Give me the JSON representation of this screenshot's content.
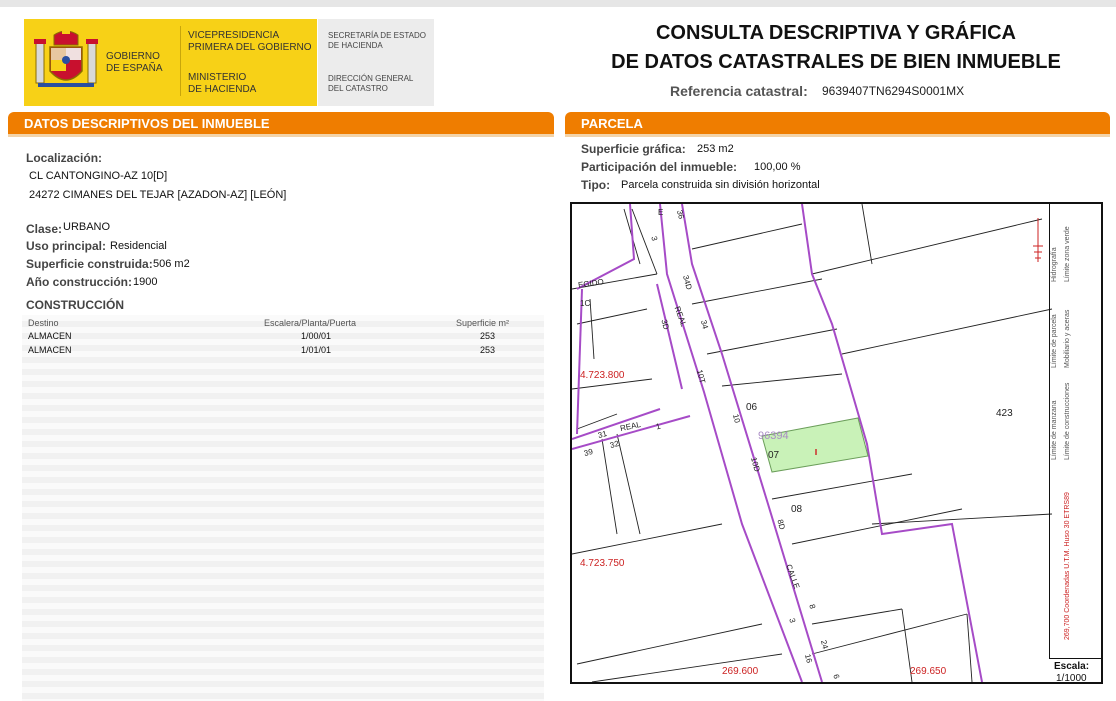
{
  "header": {
    "logo_left_line1": "GOBIERNO",
    "logo_left_line2": "DE ESPAÑA",
    "vice_line1": "VICEPRESIDENCIA",
    "vice_line2": "PRIMERA DEL GOBIERNO",
    "min_line1": "MINISTERIO",
    "min_line2": "DE HACIENDA",
    "sec_line1": "SECRETARÍA DE ESTADO",
    "sec_line2": "DE HACIENDA",
    "dir_line1": "DIRECCIÓN GENERAL",
    "dir_line2": "DEL CATASTRO",
    "title_line1": "CONSULTA DESCRIPTIVA Y GRÁFICA",
    "title_line2": "DE DATOS CATASTRALES DE BIEN INMUEBLE",
    "ref_label": "Referencia catastral:",
    "ref_value": "9639407TN6294S0001MX"
  },
  "left": {
    "section_title": "DATOS DESCRIPTIVOS DEL INMUEBLE",
    "localizacion_label": "Localización:",
    "address_line1": "CL CANTONGINO-AZ 10[D]",
    "address_line2": "24272 CIMANES DEL TEJAR [AZADON-AZ] [LEÓN]",
    "clase_label": "Clase:",
    "clase_value": "URBANO",
    "uso_label": "Uso principal:",
    "uso_value": "Residencial",
    "sup_label": "Superficie construida:",
    "sup_value": "506 m2",
    "anio_label": "Año construcción:",
    "anio_value": "1900",
    "construccion_title": "CONSTRUCCIÓN",
    "table": {
      "headers": [
        "Destino",
        "Escalera/Planta/Puerta",
        "Superficie m²"
      ],
      "rows": [
        [
          "ALMACEN",
          "1/00/01",
          "253"
        ],
        [
          "ALMACEN",
          "1/01/01",
          "253"
        ]
      ]
    }
  },
  "right": {
    "section_title": "PARCELA",
    "sup_grafica_label": "Superficie gráfica:",
    "sup_grafica_value": "253 m2",
    "participacion_label": "Participación del inmueble:",
    "participacion_value": "100,00 %",
    "tipo_label": "Tipo:",
    "tipo_value": "Parcela construida sin división horizontal"
  },
  "map": {
    "coord_y1": "4.723.800",
    "coord_y2": "4.723.750",
    "coord_x1": "269.600",
    "coord_x2": "269.650",
    "manzana": "96394",
    "parcels": [
      "06",
      "07",
      "08",
      "423"
    ],
    "street_labels": [
      "EGIDO",
      "REAL",
      "REAL",
      "CALLE"
    ],
    "numbers": [
      "36",
      "3",
      "34D",
      "34",
      "3D",
      "10T",
      "10",
      "10D",
      "8D",
      "8",
      "3",
      "24",
      "16",
      "6",
      "1",
      "31",
      "32",
      "39",
      "1C",
      "E"
    ],
    "legend": {
      "hidrografia": "Hidrografía",
      "limite_zona_verde": "Límite zona verde",
      "limite_parcela": "Límite de parcela",
      "mobiliario": "Mobiliario y aceras",
      "limite_manzana": "Límite de manzana",
      "limite_construcciones": "Límite de construcciones",
      "coordenadas": "269,700 Coordenadas U.T.M. Huso 30 ETRS89",
      "escala_label": "Escala:",
      "escala_value": "1/1000"
    },
    "colors": {
      "parcel_line": "#a64bc7",
      "highlight": "#c9f2b8",
      "coord_text": "#cc2222"
    }
  }
}
